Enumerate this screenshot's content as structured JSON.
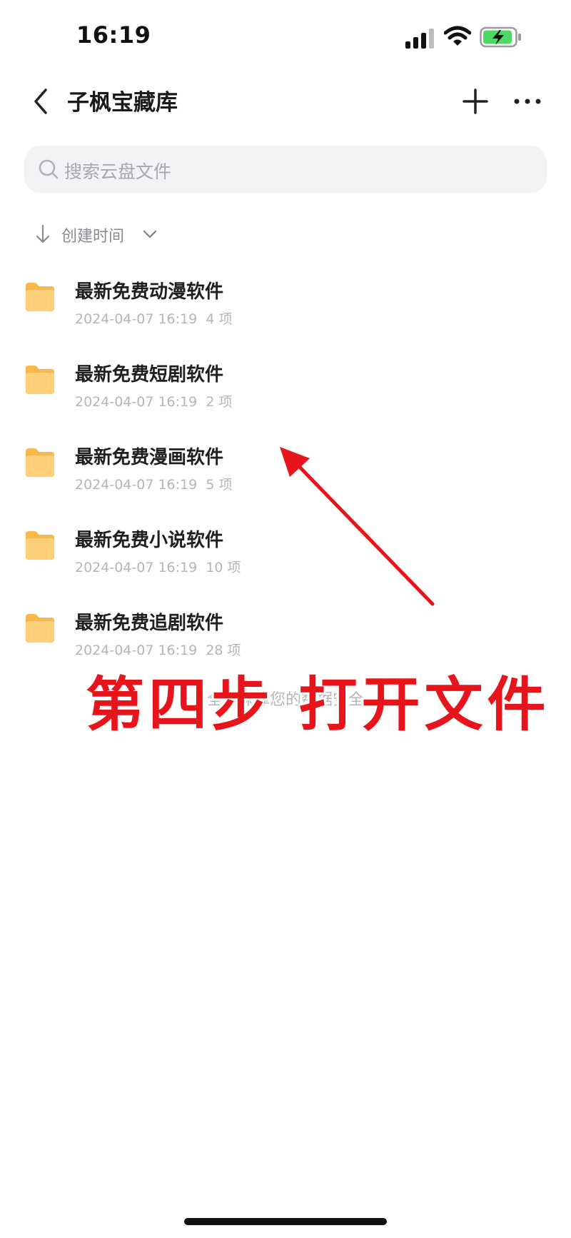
{
  "status_bar": {
    "time": "16:19"
  },
  "nav": {
    "title": "子枫宝藏库"
  },
  "search": {
    "placeholder": "搜索云盘文件"
  },
  "sort": {
    "label": "创建时间"
  },
  "files": [
    {
      "name": "最新免费动漫软件",
      "date": "2024-04-07 16:19",
      "count": "4 项"
    },
    {
      "name": "最新免费短剧软件",
      "date": "2024-04-07 16:19",
      "count": "2 项"
    },
    {
      "name": "最新免费漫画软件",
      "date": "2024-04-07 16:19",
      "count": "5 项"
    },
    {
      "name": "最新免费小说软件",
      "date": "2024-04-07 16:19",
      "count": "10 项"
    },
    {
      "name": "最新免费追剧软件",
      "date": "2024-04-07 16:19",
      "count": "28 项"
    }
  ],
  "footer": {
    "note": "全力保障您的数据安全"
  },
  "overlay": {
    "text": "第四步 打开文件"
  },
  "colors": {
    "folder": "#fcc865",
    "annotation_red": "#e8141b",
    "battery_green": "#4cd964"
  },
  "icons": [
    "signal-icon",
    "wifi-icon",
    "battery-charging-icon",
    "back-icon",
    "add-icon",
    "more-icon",
    "search-icon",
    "sort-arrow-icon",
    "chevron-down-icon",
    "folder-icon"
  ]
}
